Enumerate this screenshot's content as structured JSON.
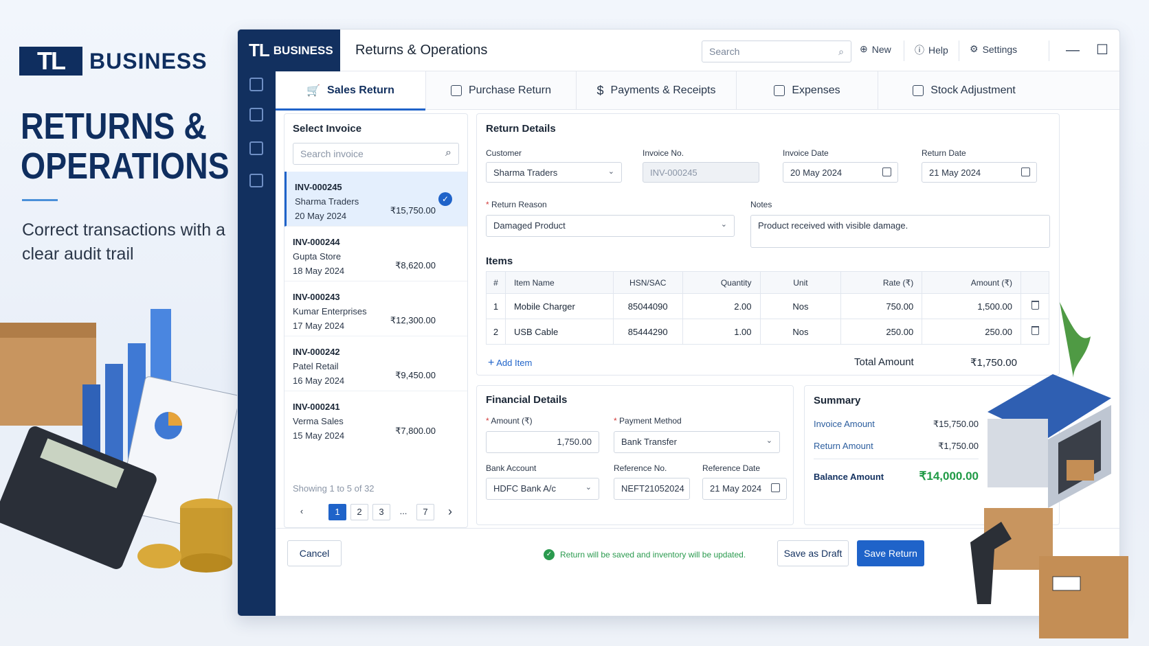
{
  "promo": {
    "brand_mark": "TL",
    "brand_word": "BUSINESS",
    "title": "RETURNS & OPERATIONS",
    "subtitle": "Correct transactions with a clear audit trail"
  },
  "app": {
    "logo_mark": "TL",
    "logo_word": "BUSINESS",
    "title": "Returns & Operations",
    "search_placeholder": "Search",
    "actions": {
      "new": "New",
      "help": "Help",
      "settings": "Settings"
    }
  },
  "sidebar_icons": [
    "returns-icon",
    "approvals-icon",
    "inventory-icon",
    "audit-icon"
  ],
  "tabs": [
    {
      "label": "Sales Return",
      "icon": "cart-icon",
      "active": true
    },
    {
      "label": "Purchase Return",
      "icon": "basket-icon"
    },
    {
      "label": "Payments & Receipts",
      "icon": "dollar-icon"
    },
    {
      "label": "Expenses",
      "icon": "receipt-icon"
    },
    {
      "label": "Stock Adjustment",
      "icon": "warehouse-icon"
    }
  ],
  "invoice_panel": {
    "title": "Select Invoice",
    "search_placeholder": "Search invoice",
    "items": [
      {
        "no": "INV-000245",
        "customer": "Sharma Traders",
        "date": "20 May 2024",
        "amount": "₹15,750.00",
        "selected": true
      },
      {
        "no": "INV-000244",
        "customer": "Gupta Store",
        "date": "18 May 2024",
        "amount": "₹8,620.00"
      },
      {
        "no": "INV-000243",
        "customer": "Kumar Enterprises",
        "date": "17 May 2024",
        "amount": "₹12,300.00"
      },
      {
        "no": "INV-000242",
        "customer": "Patel Retail",
        "date": "16 May 2024",
        "amount": "₹9,450.00"
      },
      {
        "no": "INV-000241",
        "customer": "Verma Sales",
        "date": "15 May 2024",
        "amount": "₹7,800.00"
      }
    ],
    "showing": "Showing 1 to 5 of 32",
    "pages": [
      "1",
      "2",
      "3",
      "...",
      "7"
    ],
    "current_page": "1"
  },
  "return_details": {
    "title": "Return Details",
    "customer_label": "Customer",
    "customer_value": "Sharma Traders",
    "invoice_no_label": "Invoice No.",
    "invoice_no_value": "INV-000245",
    "invoice_date_label": "Invoice Date",
    "invoice_date_value": "20 May 2024",
    "return_date_label": "Return Date",
    "return_date_value": "21 May 2024",
    "reason_label": "Return Reason",
    "reason_value": "Damaged Product",
    "notes_label": "Notes",
    "notes_value": "Product received with visible damage."
  },
  "items": {
    "title": "Items",
    "columns": [
      "#",
      "Item Name",
      "HSN/SAC",
      "Quantity",
      "Unit",
      "Rate (₹)",
      "Amount (₹)"
    ],
    "rows": [
      {
        "n": "1",
        "name": "Mobile Charger",
        "hsn": "85044090",
        "qty": "2.00",
        "unit": "Nos",
        "rate": "750.00",
        "amount": "1,500.00"
      },
      {
        "n": "2",
        "name": "USB Cable",
        "hsn": "85444290",
        "qty": "1.00",
        "unit": "Nos",
        "rate": "250.00",
        "amount": "250.00"
      }
    ],
    "add_label": "Add Item",
    "total_label": "Total Amount",
    "total_value": "₹1,750.00"
  },
  "financial": {
    "title": "Financial Details",
    "amount_label": "Amount (₹)",
    "amount_value": "1,750.00",
    "method_label": "Payment Method",
    "method_value": "Bank Transfer",
    "bank_label": "Bank Account",
    "bank_value": "HDFC Bank A/c",
    "ref_label": "Reference No.",
    "ref_value": "NEFT21052024",
    "ref_date_label": "Reference Date",
    "ref_date_value": "21 May 2024"
  },
  "summary": {
    "title": "Summary",
    "invoice_label": "Invoice Amount",
    "invoice_value": "₹15,750.00",
    "return_label": "Return Amount",
    "return_value": "₹1,750.00",
    "balance_label": "Balance Amount",
    "balance_value": "₹14,000.00",
    "balance_color": "#1f9a45"
  },
  "footer": {
    "cancel": "Cancel",
    "note": "Return will be saved and inventory will be updated.",
    "draft": "Save as Draft",
    "save": "Save Return"
  },
  "colors": {
    "brand": "#12305f",
    "accent": "#1f63c9",
    "success": "#2a9a4e"
  }
}
